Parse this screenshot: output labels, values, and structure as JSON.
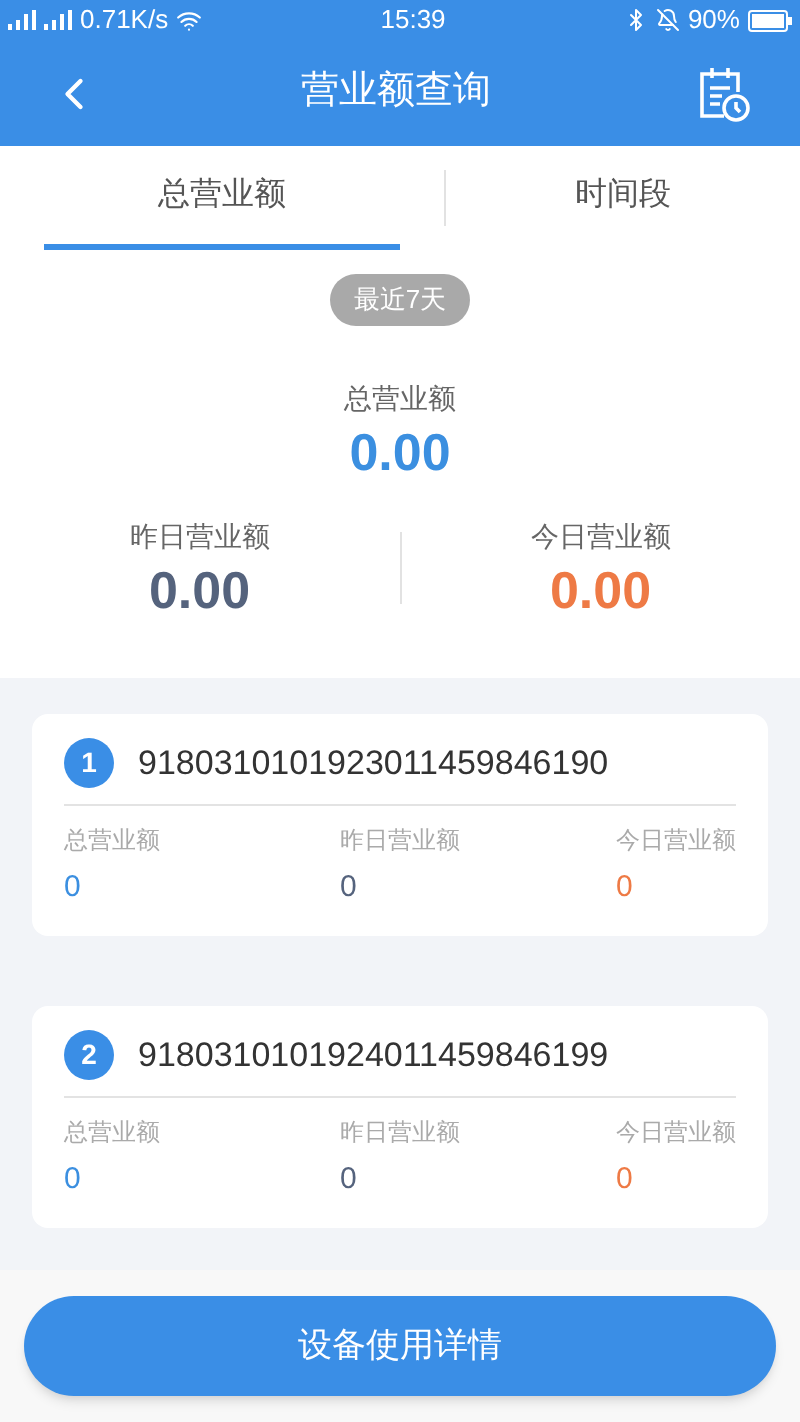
{
  "status_bar": {
    "speed": "0.71K/s",
    "time": "15:39",
    "battery": "90%"
  },
  "header": {
    "title": "营业额查询"
  },
  "tabs": [
    {
      "label": "总营业额",
      "selected": true
    },
    {
      "label": "时间段",
      "selected": false
    }
  ],
  "period": "最近7天",
  "summary": {
    "total_label": "总营业额",
    "total": "0.00",
    "yesterday_label": "昨日营业额",
    "yesterday": "0.00",
    "today_label": "今日营业额",
    "today": "0.00"
  },
  "devices": [
    {
      "index": "1",
      "id": "9180310101923011459846190",
      "labels": [
        "总营业额",
        "昨日营业额",
        "今日营业额"
      ],
      "values": [
        "0",
        "0",
        "0"
      ]
    },
    {
      "index": "2",
      "id": "9180310101924011459846199",
      "labels": [
        "总营业额",
        "昨日营业额",
        "今日营业额"
      ],
      "values": [
        "0",
        "0",
        "0"
      ]
    }
  ],
  "button": "设备使用详情"
}
